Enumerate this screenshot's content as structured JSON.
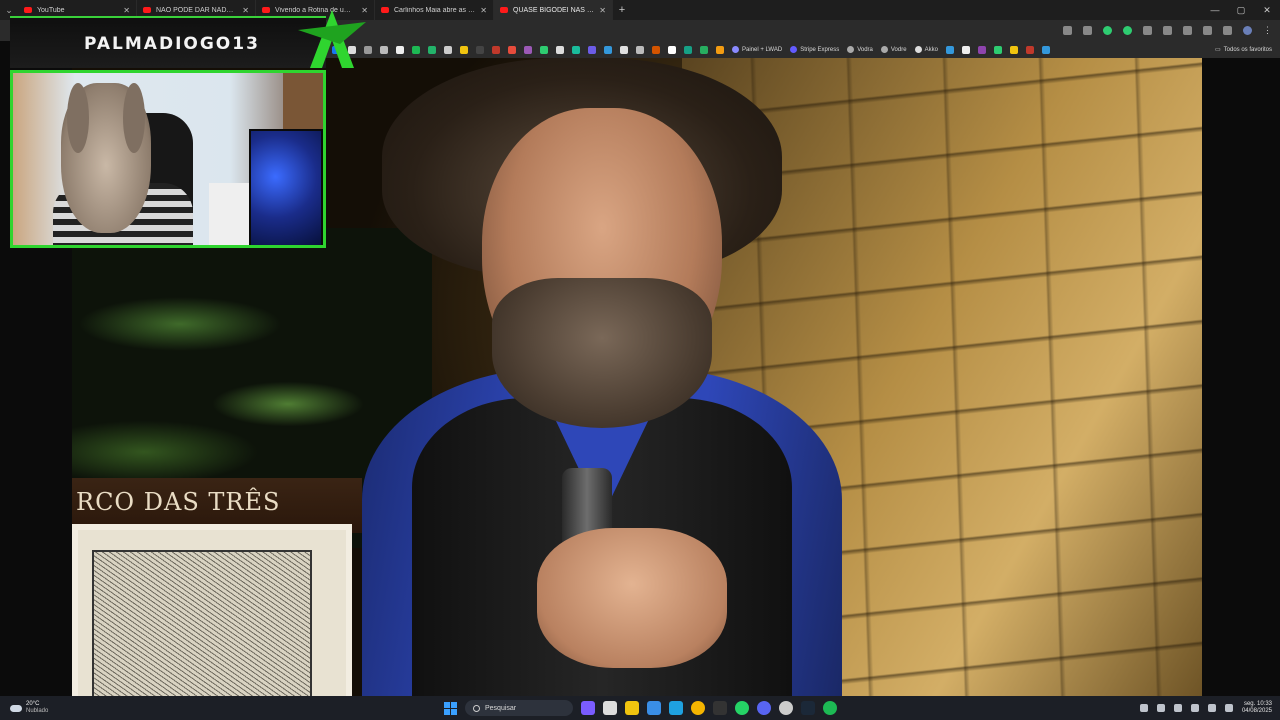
{
  "browser": {
    "tabs": [
      {
        "label": "YouTube",
        "active": false
      },
      {
        "label": "NÃO PODE DAR NADA ERRADO",
        "active": false
      },
      {
        "label": "Vivendo a Rotina de um Milion",
        "active": false
      },
      {
        "label": "Carlinhos Maia abre as portas",
        "active": false
      },
      {
        "label": "QUASE BIGODEI NAS CATA",
        "active": true
      }
    ],
    "bookmarks": [
      {
        "label": "Painel + LWAD"
      },
      {
        "label": "Stripe Express"
      },
      {
        "label": "Vodra"
      },
      {
        "label": "Vodre"
      },
      {
        "label": "Akko"
      }
    ],
    "all_bookmarks_label": "Todos os favoritos"
  },
  "overlay": {
    "streamer_name": "PALMADIOGO13"
  },
  "video": {
    "sign_text": "RCO DAS TRÊS"
  },
  "taskbar": {
    "weather_temp": "20°C",
    "weather_condition": "Nublado",
    "search_label": "Pesquisar",
    "clock_time": "10:33",
    "clock_date": "04/08/2025",
    "clock_day": "seg."
  },
  "colors": {
    "overlay_accent": "#2fd52f",
    "youtube_red": "#ff1a1a",
    "taskbar_bg": "#1c1f26"
  }
}
